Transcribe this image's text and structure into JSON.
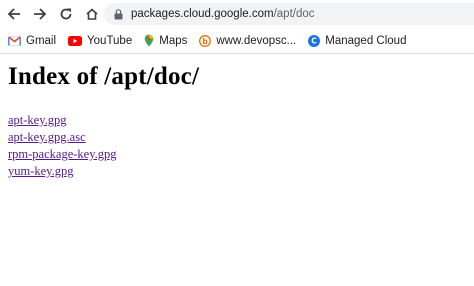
{
  "browser": {
    "url_host": "packages.cloud.google.com",
    "url_path": "/apt/doc"
  },
  "bookmarks": [
    {
      "label": "Gmail",
      "icon": "gmail-icon"
    },
    {
      "label": "YouTube",
      "icon": "youtube-icon"
    },
    {
      "label": "Maps",
      "icon": "maps-icon"
    },
    {
      "label": "www.devopsc...",
      "icon": "devops-site-icon"
    },
    {
      "label": "Managed Cloud",
      "icon": "managed-cloud-icon"
    }
  ],
  "page": {
    "title": "Index of /apt/doc/",
    "files": [
      "apt-key.gpg",
      "apt-key.gpg.asc",
      "rpm-package-key.gpg",
      "yum-key.gpg"
    ]
  },
  "colors": {
    "visited_link": "#551a8b",
    "omnibox_bg": "#f1f3f4"
  }
}
